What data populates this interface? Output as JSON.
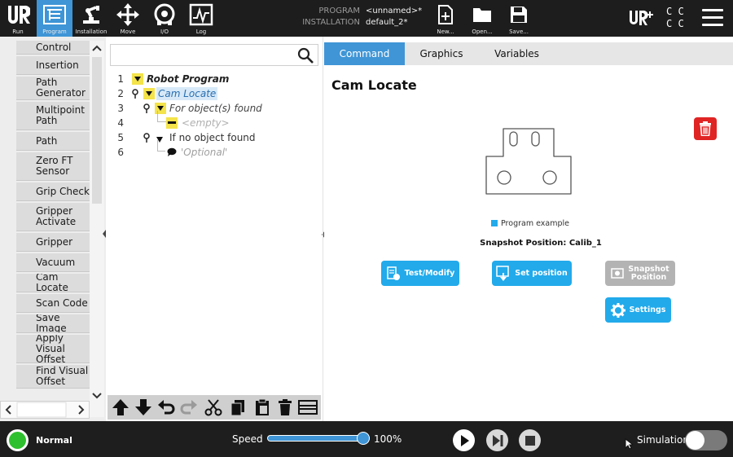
{
  "top_nav": {
    "buttons": [
      {
        "label": "Run",
        "icon": "ur-logo-icon"
      },
      {
        "label": "Program",
        "icon": "program-tree-icon",
        "active": true
      },
      {
        "label": "Installation",
        "icon": "robot-arm-icon"
      },
      {
        "label": "Move",
        "icon": "move-arrows-icon"
      },
      {
        "label": "I/O",
        "icon": "io-icon"
      },
      {
        "label": "Log",
        "icon": "log-chart-icon"
      }
    ],
    "program_label": "PROGRAM",
    "program_value": "<unnamed>*",
    "installation_label": "INSTALLATION",
    "installation_value": "default_2*",
    "file_buttons": [
      {
        "label": "New...",
        "icon": "new-file-icon"
      },
      {
        "label": "Open...",
        "icon": "open-folder-icon"
      },
      {
        "label": "Save...",
        "icon": "save-disk-icon"
      }
    ],
    "urplus_label": "UR+",
    "cc_label": "C C C C",
    "accent_color": "#3f95d6"
  },
  "node_list": {
    "items": [
      "Force\nControl",
      "Insertion",
      "Path\nGenerator",
      "Multipoint\nPath",
      "Path",
      "Zero FT\nSensor",
      "Grip Check",
      "Gripper\nActivate",
      "Gripper",
      "Vacuum",
      "Cam Locate",
      "Scan Code",
      "Save Image",
      "Apply Visual\nOffset",
      "Find Visual\nOffset"
    ]
  },
  "tree": {
    "search_placeholder": "",
    "rows": [
      {
        "num": "1",
        "text": "Robot Program",
        "style": "bold-italic"
      },
      {
        "num": "2",
        "text": "Cam Locate",
        "style": "italic-selected"
      },
      {
        "num": "3",
        "text": "For object(s) found",
        "style": "italic"
      },
      {
        "num": "4",
        "text": "<empty>",
        "style": "italic-muted"
      },
      {
        "num": "5",
        "text": "If no object found",
        "style": "normal"
      },
      {
        "num": "6",
        "text": "'Optional'",
        "style": "italic-muted"
      }
    ],
    "toolbar": [
      "move-up-icon",
      "move-down-icon",
      "undo-icon",
      "redo-icon",
      "cut-icon",
      "copy-icon",
      "paste-icon",
      "delete-icon",
      "suppress-icon"
    ]
  },
  "right": {
    "tabs": [
      "Command",
      "Graphics",
      "Variables"
    ],
    "active_tab": "Command",
    "title": "Cam Locate",
    "program_example_label": "Program example",
    "snapshot_position_text": "Snapshot Position: Calib_1",
    "buttons": {
      "test_modify": "Test/Modify",
      "set_position": "Set position",
      "snapshot_position": "Snapshot\nPosition",
      "settings": "Settings"
    },
    "delete_color": "#e02424"
  },
  "bottom": {
    "status": "Normal",
    "status_color": "#2ec02e",
    "speed_label": "Speed",
    "speed_value": "100%",
    "speed_fraction": 1.0,
    "simulation_label": "Simulation",
    "simulation_on": false
  }
}
